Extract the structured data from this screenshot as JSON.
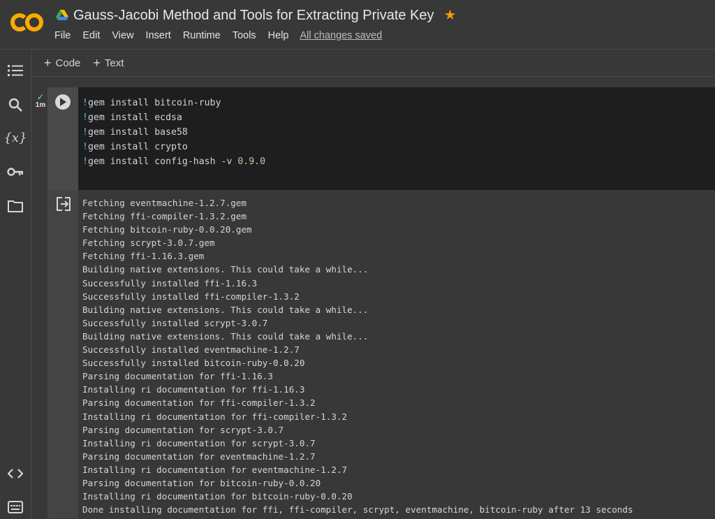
{
  "header": {
    "title": "Gauss-Jacobi Method and Tools for Extracting Private Key",
    "logo_text": "CO",
    "menu": [
      "File",
      "Edit",
      "View",
      "Insert",
      "Runtime",
      "Tools",
      "Help"
    ],
    "save_status": "All changes saved"
  },
  "toolbar": {
    "code_label": "Code",
    "text_label": "Text"
  },
  "sidebar": {
    "items": [
      {
        "icon": "table-of-contents-icon"
      },
      {
        "icon": "search-icon"
      },
      {
        "icon": "variables-icon",
        "label": "{x}"
      },
      {
        "icon": "key-icon"
      },
      {
        "icon": "folder-icon"
      },
      {
        "icon": "code-snippets-icon"
      },
      {
        "icon": "terminal-icon"
      }
    ]
  },
  "cell": {
    "status_time": "1m",
    "code": [
      {
        "cmd": "gem install bitcoin-ruby",
        "ver": ""
      },
      {
        "cmd": "gem install ecdsa",
        "ver": ""
      },
      {
        "cmd": "gem install base58",
        "ver": ""
      },
      {
        "cmd": "gem install crypto",
        "ver": ""
      },
      {
        "cmd": "gem install config-hash -v ",
        "ver": "0.9.0"
      }
    ],
    "output": [
      "Fetching eventmachine-1.2.7.gem",
      "Fetching ffi-compiler-1.3.2.gem",
      "Fetching bitcoin-ruby-0.0.20.gem",
      "Fetching scrypt-3.0.7.gem",
      "Fetching ffi-1.16.3.gem",
      "Building native extensions. This could take a while...",
      "Successfully installed ffi-1.16.3",
      "Successfully installed ffi-compiler-1.3.2",
      "Building native extensions. This could take a while...",
      "Successfully installed scrypt-3.0.7",
      "Building native extensions. This could take a while...",
      "Successfully installed eventmachine-1.2.7",
      "Successfully installed bitcoin-ruby-0.0.20",
      "Parsing documentation for ffi-1.16.3",
      "Installing ri documentation for ffi-1.16.3",
      "Parsing documentation for ffi-compiler-1.3.2",
      "Installing ri documentation for ffi-compiler-1.3.2",
      "Parsing documentation for scrypt-3.0.7",
      "Installing ri documentation for scrypt-3.0.7",
      "Parsing documentation for eventmachine-1.2.7",
      "Installing ri documentation for eventmachine-1.2.7",
      "Parsing documentation for bitcoin-ruby-0.0.20",
      "Installing ri documentation for bitcoin-ruby-0.0.20",
      "Done installing documentation for ffi, ffi-compiler, scrypt, eventmachine, bitcoin-ruby after 13 seconds"
    ]
  },
  "colors": {
    "logo_orange": "#f9ab00",
    "star": "#f29900",
    "check": "#5bb974",
    "bang": "#4fc1ff",
    "number": "#b5cea8"
  }
}
